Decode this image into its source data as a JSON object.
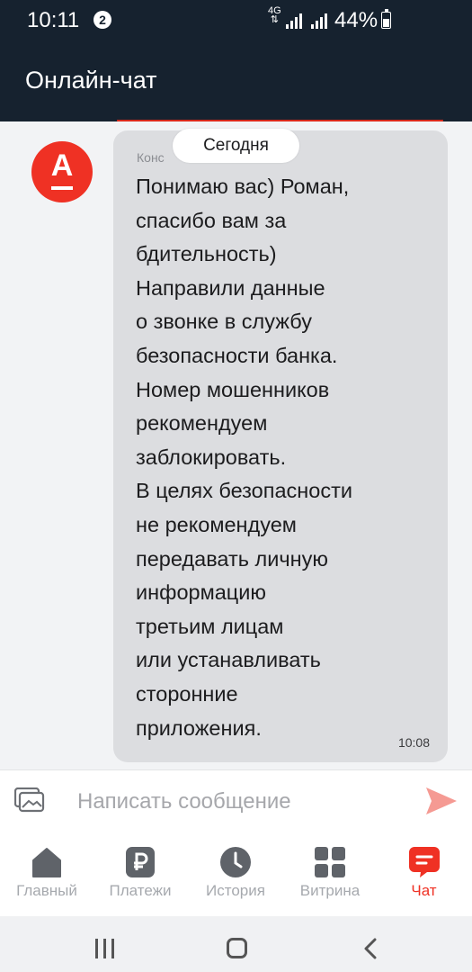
{
  "status_bar": {
    "time": "10:11",
    "notification_count": "2",
    "network_type": "4G",
    "battery_percent": "44%"
  },
  "header": {
    "title": "Онлайн-чат"
  },
  "chat": {
    "date_separator": "Сегодня",
    "message": {
      "sender_partial": "Конс",
      "text": "Понимаю вас) Роман,\nспасибо вам за\nбдительность)\nНаправили данные\nо звонке в службу\nбезопасности банка.\nНомер мошенников\nрекомендуем\nзаблокировать.\nВ целях безопасности\nне рекомендуем\nпередавать личную\nинформацию\nтретьим лицам\nили устанавливать\nсторонние\nприложения.",
      "time": "10:08"
    },
    "avatar_letter": "А"
  },
  "composer": {
    "placeholder": "Написать сообщение"
  },
  "tabs": [
    {
      "label": "Главный",
      "icon": "home-icon",
      "active": false
    },
    {
      "label": "Платежи",
      "icon": "ruble-icon",
      "active": false
    },
    {
      "label": "История",
      "icon": "clock-icon",
      "active": false
    },
    {
      "label": "Витрина",
      "icon": "grid-icon",
      "active": false
    },
    {
      "label": "Чат",
      "icon": "chat-icon",
      "active": true
    }
  ],
  "colors": {
    "brand_red": "#ef3124",
    "header_bg": "#16222f",
    "bubble_bg": "#dcdde0",
    "tab_inactive": "#a6a9ae"
  }
}
